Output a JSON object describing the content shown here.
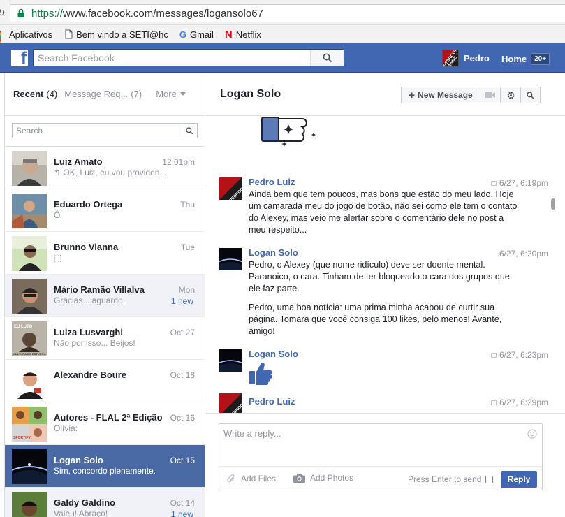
{
  "browser": {
    "url_protocol": "https://",
    "url_rest": "www.facebook.com/messages/logansolo67",
    "bookmarks": [
      {
        "label": "Aplicativos",
        "icon": "apps-grid-icon"
      },
      {
        "label": "Bem vindo a SETI@hc",
        "icon": "page-icon"
      },
      {
        "label": "Gmail",
        "icon": "google-icon"
      },
      {
        "label": "Netflix",
        "icon": "netflix-icon"
      }
    ]
  },
  "topbar": {
    "logo": "f",
    "search_placeholder": "Search Facebook",
    "user_name": "Pedro",
    "home_label": "Home",
    "home_badge": "20+",
    "avatar_text": "PEDROOM LANNE"
  },
  "sidebar": {
    "tab_recent": "Recent",
    "tab_recent_count": "(4)",
    "tab_requests": "Message Req...",
    "tab_requests_count": "(7)",
    "tab_more": "More",
    "search_placeholder": "Search",
    "conversations": [
      {
        "name": "Luiz Amato",
        "time": "12:01pm",
        "preview": "↰ OK, Luiz, eu vou providen...",
        "new": "",
        "state": "normal"
      },
      {
        "name": "Eduardo Ortega",
        "time": "Thu",
        "preview": "Ô",
        "new": "",
        "state": "normal"
      },
      {
        "name": "Brunno Vianna",
        "time": "Tue",
        "preview": "⬚",
        "new": "",
        "state": "normal"
      },
      {
        "name": "Mário Ramão Villalva",
        "time": "Mon",
        "preview": "Gracias... aguardo.",
        "new": "1 new",
        "state": "unread"
      },
      {
        "name": "Luiza Lusvarghi",
        "time": "Oct 27",
        "preview": "Não por isso... Beijos!",
        "new": "",
        "state": "normal"
      },
      {
        "name": "Alexandre Boure",
        "time": "Oct 18",
        "preview": "",
        "new": "",
        "state": "normal"
      },
      {
        "name": "Autores - FLAL 2ª Edição",
        "time": "Oct 16",
        "preview": "Olívia:",
        "new": "",
        "state": "normal"
      },
      {
        "name": "Logan Solo",
        "time": "Oct 15",
        "preview": "Sim, concordo plenamente.",
        "new": "",
        "state": "active"
      },
      {
        "name": "Galdy Galdino",
        "time": "Oct 14",
        "preview": "Valeu! Abraço!",
        "new": "1 new",
        "state": "unread"
      }
    ],
    "avatar_labels": {
      "luiza": "EU LUTO",
      "luiza_sub": "CULTURA DO ESTUPRO",
      "autores": "SPORTIFY"
    }
  },
  "thread": {
    "title": "Logan Solo",
    "new_message_label": "New Message",
    "messages": [
      {
        "sender": "Pedro Luiz",
        "time": "6/27, 6:19pm",
        "paragraphs": [
          "Ainda bem que tem poucos, mas bons que estão do meu lado. Hoje um camarada meu do jogo de botão, não sei como ele tem o contato do Alexey, mas veio me alertar sobre o comentário dele no post a meu respeito..."
        ]
      },
      {
        "sender": "Logan Solo",
        "time": "6/27, 6:20pm",
        "paragraphs": [
          "Pedro, o Alexey (que nome ridículo) deve ser doente mental. Paranoico, o cara. Tinham de ter bloqueado o cara dos grupos que ele faz parte.",
          "Pedro, uma boa notícia: uma prima minha acabou de curtir sua página. Tomara que você consiga 100 likes, pelo menos! Avante, amigo!"
        ]
      },
      {
        "sender": "Logan Solo",
        "time": "6/27, 6:23pm",
        "paragraphs": []
      },
      {
        "sender": "Pedro Luiz",
        "time": "6/27, 6:29pm",
        "paragraphs": []
      }
    ]
  },
  "composer": {
    "placeholder": "Write a reply...",
    "add_files": "Add Files",
    "add_photos": "Add Photos",
    "press_enter": "Press Enter to send",
    "reply": "Reply"
  },
  "colors": {
    "fb_blue": "#4267b2",
    "active_row": "#4a6aa5",
    "unread_row": "#f0f2f8",
    "link_blue": "#4267b2"
  }
}
